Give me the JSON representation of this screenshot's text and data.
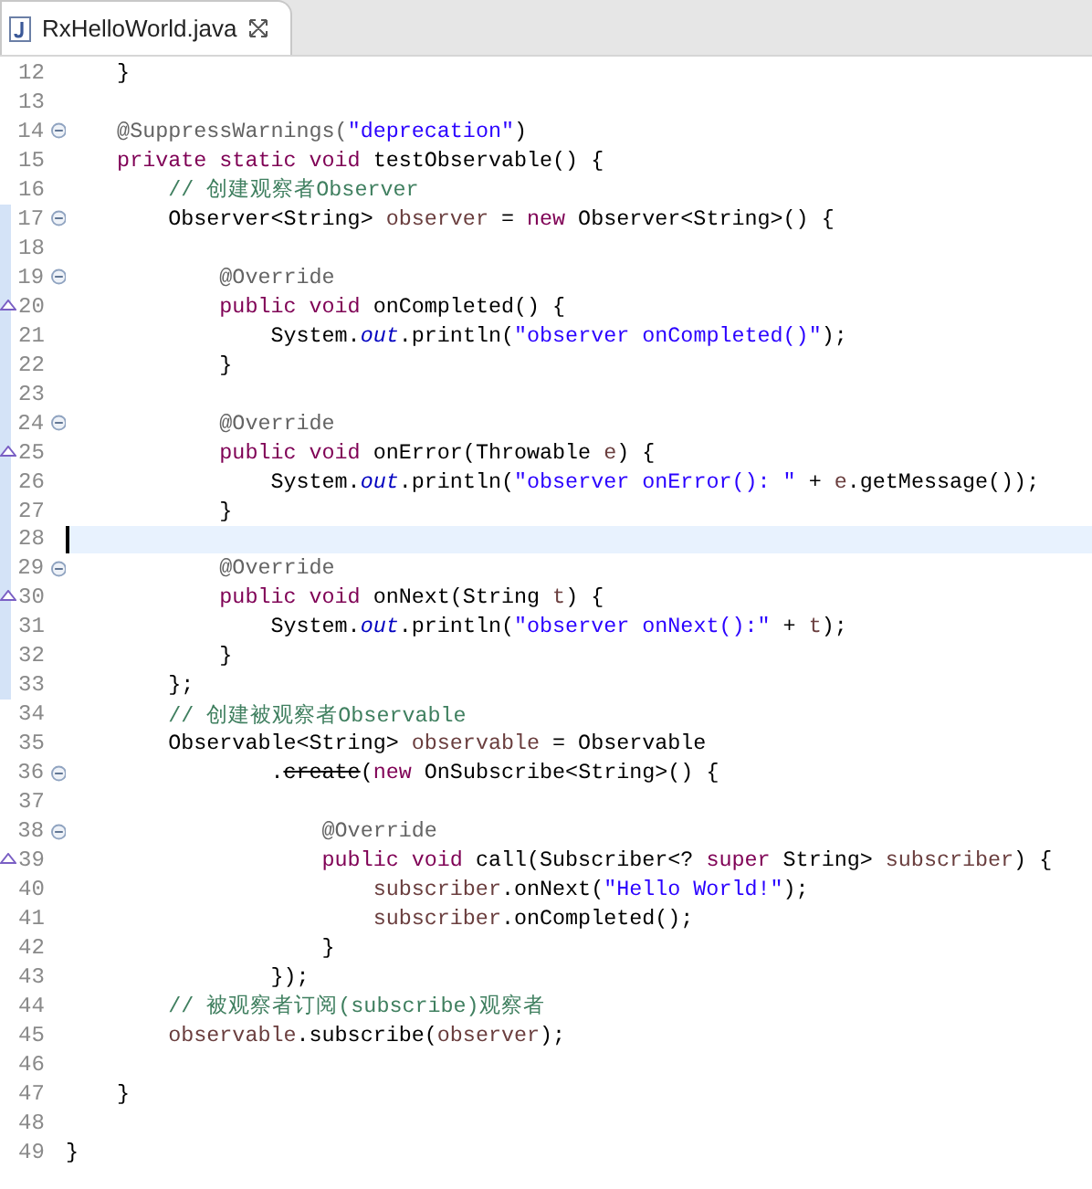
{
  "tab": {
    "title": "RxHelloWorld.java",
    "selected": true
  },
  "lines": [
    {
      "number": "12",
      "tokens": [
        {
          "kind": "plain",
          "text": "    }"
        }
      ]
    },
    {
      "number": "13"
    },
    {
      "number": "14",
      "fold": true,
      "tokens": [
        {
          "kind": "annotation",
          "text": "    @SuppressWarnings("
        },
        {
          "kind": "string",
          "text": "\"deprecation\""
        },
        {
          "kind": "plain",
          "text": ")"
        }
      ]
    },
    {
      "number": "15",
      "tokens": [
        {
          "kind": "keyword",
          "text": "    private static void"
        },
        {
          "kind": "plain",
          "text": " testObservable() {"
        }
      ]
    },
    {
      "number": "16",
      "tokens": [
        {
          "kind": "comment",
          "text": "        // 创建观察者Observer"
        }
      ]
    },
    {
      "number": "17",
      "fold": true,
      "changed": true,
      "tokens": [
        {
          "kind": "plain",
          "text": "        Observer<String> "
        },
        {
          "kind": "local",
          "text": "observer"
        },
        {
          "kind": "plain",
          "text": " = "
        },
        {
          "kind": "keyword",
          "text": "new"
        },
        {
          "kind": "plain",
          "text": " Observer<String>() {"
        }
      ]
    },
    {
      "number": "18",
      "changed": true
    },
    {
      "number": "19",
      "fold": true,
      "changed": true,
      "tokens": [
        {
          "kind": "annotation",
          "text": "            @Override"
        }
      ]
    },
    {
      "number": "20",
      "override": true,
      "changed": true,
      "tokens": [
        {
          "kind": "keyword",
          "text": "            public void"
        },
        {
          "kind": "plain",
          "text": " onCompleted() {"
        }
      ]
    },
    {
      "number": "21",
      "changed": true,
      "tokens": [
        {
          "kind": "plain",
          "text": "                System."
        },
        {
          "kind": "field",
          "text": "out"
        },
        {
          "kind": "plain",
          "text": ".println("
        },
        {
          "kind": "string",
          "text": "\"observer onCompleted()\""
        },
        {
          "kind": "plain",
          "text": ");"
        }
      ]
    },
    {
      "number": "22",
      "changed": true,
      "tokens": [
        {
          "kind": "plain",
          "text": "            }"
        }
      ]
    },
    {
      "number": "23",
      "changed": true
    },
    {
      "number": "24",
      "fold": true,
      "changed": true,
      "tokens": [
        {
          "kind": "annotation",
          "text": "            @Override"
        }
      ]
    },
    {
      "number": "25",
      "override": true,
      "changed": true,
      "tokens": [
        {
          "kind": "keyword",
          "text": "            public void"
        },
        {
          "kind": "plain",
          "text": " onError(Throwable "
        },
        {
          "kind": "local",
          "text": "e"
        },
        {
          "kind": "plain",
          "text": ") {"
        }
      ]
    },
    {
      "number": "26",
      "changed": true,
      "tokens": [
        {
          "kind": "plain",
          "text": "                System."
        },
        {
          "kind": "field",
          "text": "out"
        },
        {
          "kind": "plain",
          "text": ".println("
        },
        {
          "kind": "string",
          "text": "\"observer onError(): \""
        },
        {
          "kind": "plain",
          "text": " + "
        },
        {
          "kind": "local",
          "text": "e"
        },
        {
          "kind": "plain",
          "text": ".getMessage());"
        }
      ]
    },
    {
      "number": "27",
      "changed": true,
      "tokens": [
        {
          "kind": "plain",
          "text": "            }"
        }
      ]
    },
    {
      "number": "28",
      "changed": true,
      "current": true
    },
    {
      "number": "29",
      "fold": true,
      "changed": true,
      "tokens": [
        {
          "kind": "annotation",
          "text": "            @Override"
        }
      ]
    },
    {
      "number": "30",
      "override": true,
      "changed": true,
      "tokens": [
        {
          "kind": "keyword",
          "text": "            public void"
        },
        {
          "kind": "plain",
          "text": " onNext(String "
        },
        {
          "kind": "local",
          "text": "t"
        },
        {
          "kind": "plain",
          "text": ") {"
        }
      ]
    },
    {
      "number": "31",
      "changed": true,
      "tokens": [
        {
          "kind": "plain",
          "text": "                System."
        },
        {
          "kind": "field",
          "text": "out"
        },
        {
          "kind": "plain",
          "text": ".println("
        },
        {
          "kind": "string",
          "text": "\"observer onNext():\""
        },
        {
          "kind": "plain",
          "text": " + "
        },
        {
          "kind": "local",
          "text": "t"
        },
        {
          "kind": "plain",
          "text": ");"
        }
      ]
    },
    {
      "number": "32",
      "changed": true,
      "tokens": [
        {
          "kind": "plain",
          "text": "            }"
        }
      ]
    },
    {
      "number": "33",
      "changed": true,
      "tokens": [
        {
          "kind": "plain",
          "text": "        };"
        }
      ]
    },
    {
      "number": "34",
      "tokens": [
        {
          "kind": "comment",
          "text": "        // 创建被观察者Observable"
        }
      ]
    },
    {
      "number": "35",
      "tokens": [
        {
          "kind": "plain",
          "text": "        Observable<String> "
        },
        {
          "kind": "local",
          "text": "observable"
        },
        {
          "kind": "plain",
          "text": " = Observable"
        }
      ]
    },
    {
      "number": "36",
      "fold": true,
      "tokens": [
        {
          "kind": "plain",
          "text": "                ."
        },
        {
          "kind": "deprecated",
          "text": "create"
        },
        {
          "kind": "plain",
          "text": "("
        },
        {
          "kind": "keyword",
          "text": "new"
        },
        {
          "kind": "plain",
          "text": " OnSubscribe<String>() {"
        }
      ]
    },
    {
      "number": "37"
    },
    {
      "number": "38",
      "fold": true,
      "tokens": [
        {
          "kind": "annotation",
          "text": "                    @Override"
        }
      ]
    },
    {
      "number": "39",
      "override": true,
      "tokens": [
        {
          "kind": "keyword",
          "text": "                    public void"
        },
        {
          "kind": "plain",
          "text": " call(Subscriber<? "
        },
        {
          "kind": "keyword",
          "text": "super"
        },
        {
          "kind": "plain",
          "text": " String> "
        },
        {
          "kind": "local",
          "text": "subscriber"
        },
        {
          "kind": "plain",
          "text": ") {"
        }
      ]
    },
    {
      "number": "40",
      "tokens": [
        {
          "kind": "local",
          "text": "                        subscriber"
        },
        {
          "kind": "plain",
          "text": ".onNext("
        },
        {
          "kind": "string",
          "text": "\"Hello World!\""
        },
        {
          "kind": "plain",
          "text": ");"
        }
      ]
    },
    {
      "number": "41",
      "tokens": [
        {
          "kind": "local",
          "text": "                        subscriber"
        },
        {
          "kind": "plain",
          "text": ".onCompleted();"
        }
      ]
    },
    {
      "number": "42",
      "tokens": [
        {
          "kind": "plain",
          "text": "                    }"
        }
      ]
    },
    {
      "number": "43",
      "tokens": [
        {
          "kind": "plain",
          "text": "                });"
        }
      ]
    },
    {
      "number": "44",
      "tokens": [
        {
          "kind": "comment",
          "text": "        // 被观察者订阅(subscribe)观察者"
        }
      ]
    },
    {
      "number": "45",
      "tokens": [
        {
          "kind": "local",
          "text": "        observable"
        },
        {
          "kind": "plain",
          "text": ".subscribe("
        },
        {
          "kind": "local",
          "text": "observer"
        },
        {
          "kind": "plain",
          "text": ");"
        }
      ]
    },
    {
      "number": "46"
    },
    {
      "number": "47",
      "tokens": [
        {
          "kind": "plain",
          "text": "    }"
        }
      ]
    },
    {
      "number": "48"
    },
    {
      "number": "49",
      "tokens": [
        {
          "kind": "plain",
          "text": "}"
        }
      ]
    }
  ]
}
